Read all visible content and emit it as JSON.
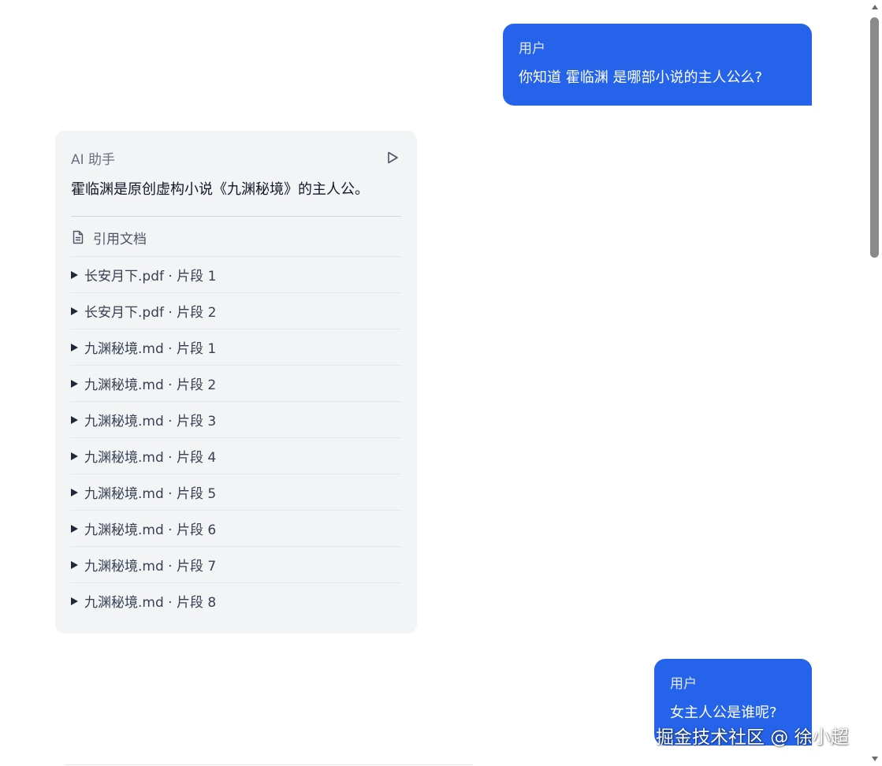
{
  "messages": [
    {
      "role_label": "用户",
      "text": "你知道 霍临渊 是哪部小说的主人公么?"
    },
    {
      "role_label": "AI 助手",
      "text": "霍临渊是原创虚构小说《九渊秘境》的主人公。",
      "play_icon": "play-icon",
      "references_title": "引用文档",
      "references_icon": "document-icon",
      "references": [
        "长安月下.pdf · 片段 1",
        "长安月下.pdf · 片段 2",
        "九渊秘境.md · 片段 1",
        "九渊秘境.md · 片段 2",
        "九渊秘境.md · 片段 3",
        "九渊秘境.md · 片段 4",
        "九渊秘境.md · 片段 5",
        "九渊秘境.md · 片段 6",
        "九渊秘境.md · 片段 7",
        "九渊秘境.md · 片段 8"
      ]
    },
    {
      "role_label": "用户",
      "text": "女主人公是谁呢?"
    }
  ],
  "watermark": "掘金技术社区 @ 徐小超",
  "colors": {
    "user_bubble": "#2563eb",
    "ai_bubble": "#f2f4f6"
  }
}
